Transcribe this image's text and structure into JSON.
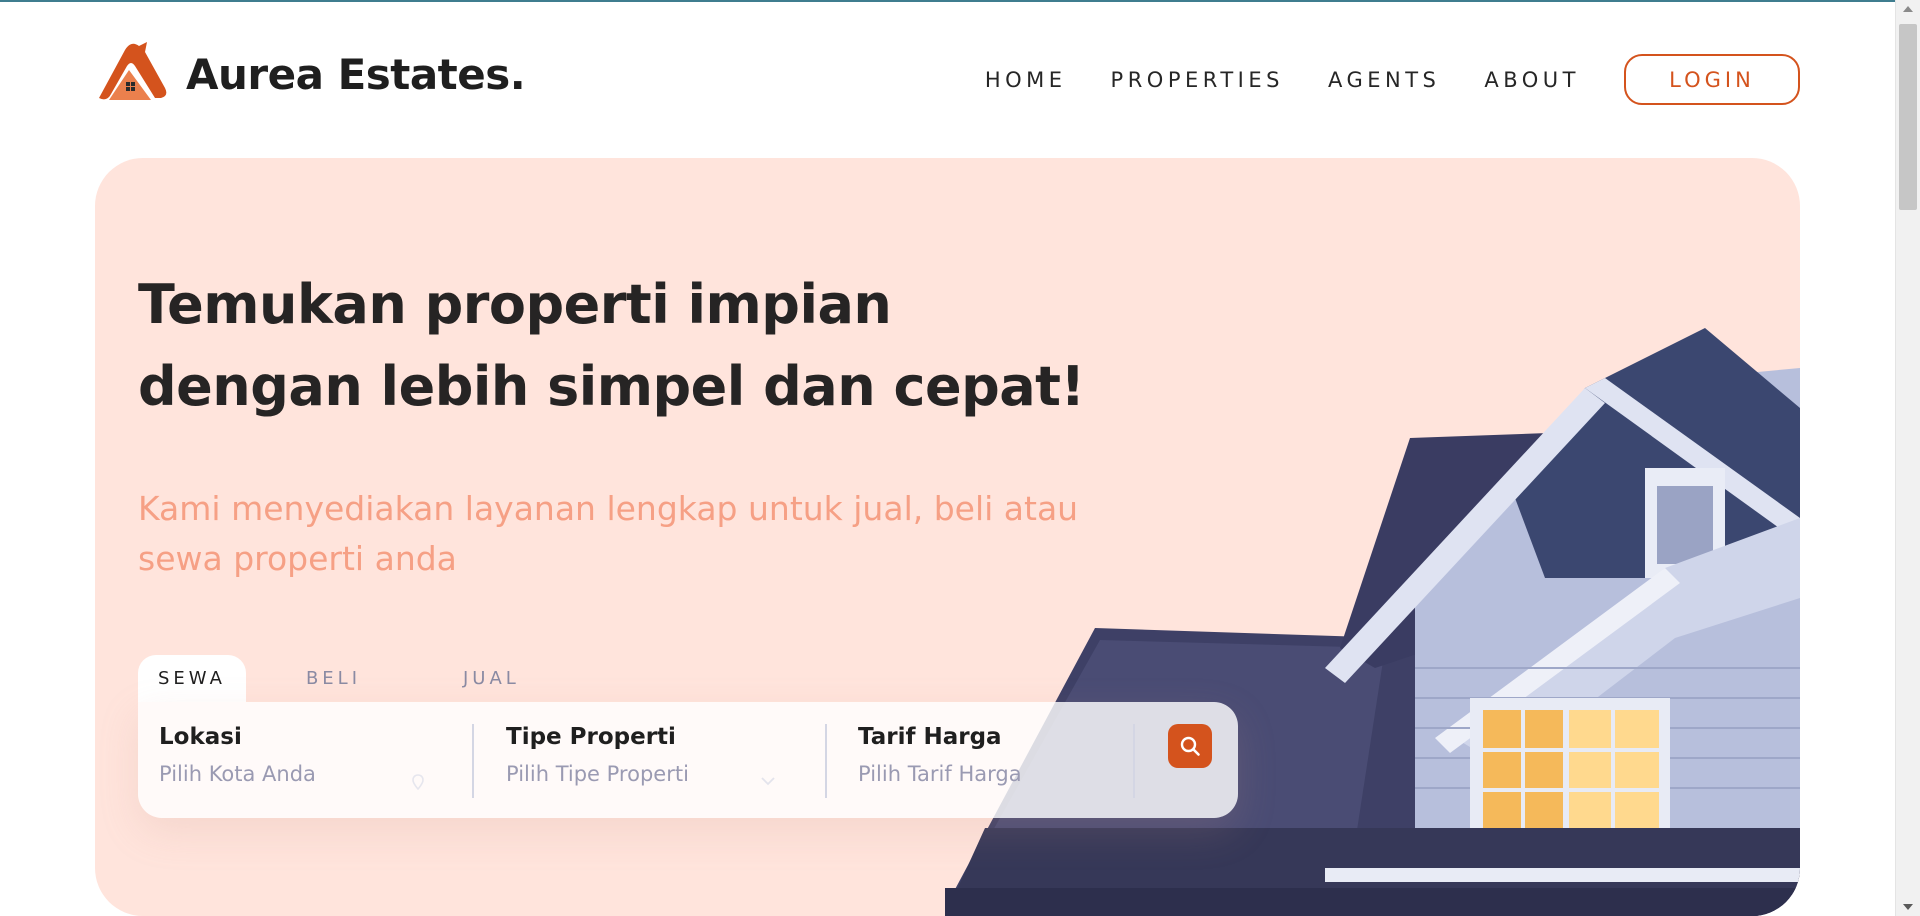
{
  "brand": {
    "name": "Aurea Estates."
  },
  "colors": {
    "accent": "#d4531d",
    "hero_bg": "#ffe4dc",
    "subtitle": "#f6a085",
    "roof": "#3e4066",
    "trim": "#aab4d6"
  },
  "nav": {
    "items": [
      {
        "label": "HOME"
      },
      {
        "label": "PROPERTIES"
      },
      {
        "label": "AGENTS"
      },
      {
        "label": "ABOUT"
      }
    ],
    "login_label": "LOGIN"
  },
  "hero": {
    "title": "Temukan properti impian dengan lebih simpel dan cepat!",
    "subtitle": "Kami menyediakan layanan lengkap untuk jual, beli atau sewa properti anda"
  },
  "search": {
    "tabs": [
      {
        "label": "SEWA",
        "active": true
      },
      {
        "label": "BELI",
        "active": false
      },
      {
        "label": "JUAL",
        "active": false
      }
    ],
    "fields": [
      {
        "label": "Lokasi",
        "placeholder": "Pilih Kota Anda",
        "icon": "location-pin-icon"
      },
      {
        "label": "Tipe Properti",
        "placeholder": "Pilih Tipe Properti",
        "icon": "chevron-down-icon"
      },
      {
        "label": "Tarif Harga",
        "placeholder": "Pilih Tarif Harga"
      }
    ],
    "button_icon": "search-icon"
  }
}
